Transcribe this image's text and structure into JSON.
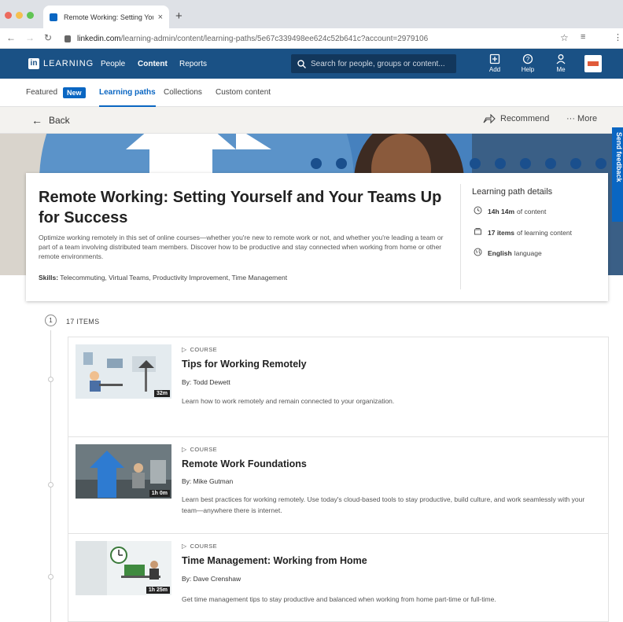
{
  "browser": {
    "tab_title": "Remote Working: Setting Yours",
    "tab_close": "×",
    "new_tab": "+",
    "url_host": "linkedin.com",
    "url_path": "/learning-admin/content/learning-paths/5e67c339498ee624c52b641c?account=2979106"
  },
  "nav": {
    "logo_letters": "in",
    "logo_text": "LEARNING",
    "links": [
      "People",
      "Content",
      "Reports"
    ],
    "active_link": "Content",
    "search_placeholder": "Search for people, groups or content...",
    "add_label": "Add",
    "help_label": "Help",
    "me_label": "Me"
  },
  "subtabs": {
    "featured": "Featured",
    "new_badge": "New",
    "learning_paths": "Learning paths",
    "collections": "Collections",
    "custom_content": "Custom content"
  },
  "actions": {
    "back": "Back",
    "recommend": "Recommend",
    "more": "More"
  },
  "feedback_label": "Send feedback",
  "path": {
    "title": "Remote Working: Setting Yourself and Your Teams Up for Success",
    "description": "Optimize working remotely in this set of online courses—whether you're new to remote work or not, and whether you're leading a team or part of a team involving distributed team members. Discover how to be productive and stay connected when working from home or other remote environments.",
    "skills_label": "Skills:",
    "skills": "Telecommuting, Virtual Teams, Productivity Improvement, Time Management",
    "details_heading": "Learning path details",
    "duration_value": "14h 14m",
    "duration_suffix": "of content",
    "items_value": "17 items",
    "items_suffix": "of learning content",
    "language_value": "English",
    "language_suffix": "language"
  },
  "list": {
    "step_number": "1",
    "items_count": "17 ITEMS",
    "courses": [
      {
        "type": "COURSE",
        "title": "Tips for Working Remotely",
        "author": "By: Todd Dewett",
        "description": "Learn how to work remotely and remain connected to your organization.",
        "duration": "32m"
      },
      {
        "type": "COURSE",
        "title": "Remote Work Foundations",
        "author": "By: Mike Gutman",
        "description": "Learn best practices for working remotely. Use today's cloud-based tools to stay productive, build culture, and work seamlessly with your team—anywhere there is internet.",
        "duration": "1h 0m"
      },
      {
        "type": "COURSE",
        "title": "Time Management: Working from Home",
        "author": "By: Dave Crenshaw",
        "description": "Get time management tips to stay productive and balanced when working from home part-time or full-time.",
        "duration": "1h 25m"
      }
    ]
  },
  "colors": {
    "brand_blue": "#0a66c2",
    "nav_bg": "#1a5185",
    "hero_bg": "#3f7dbb"
  }
}
